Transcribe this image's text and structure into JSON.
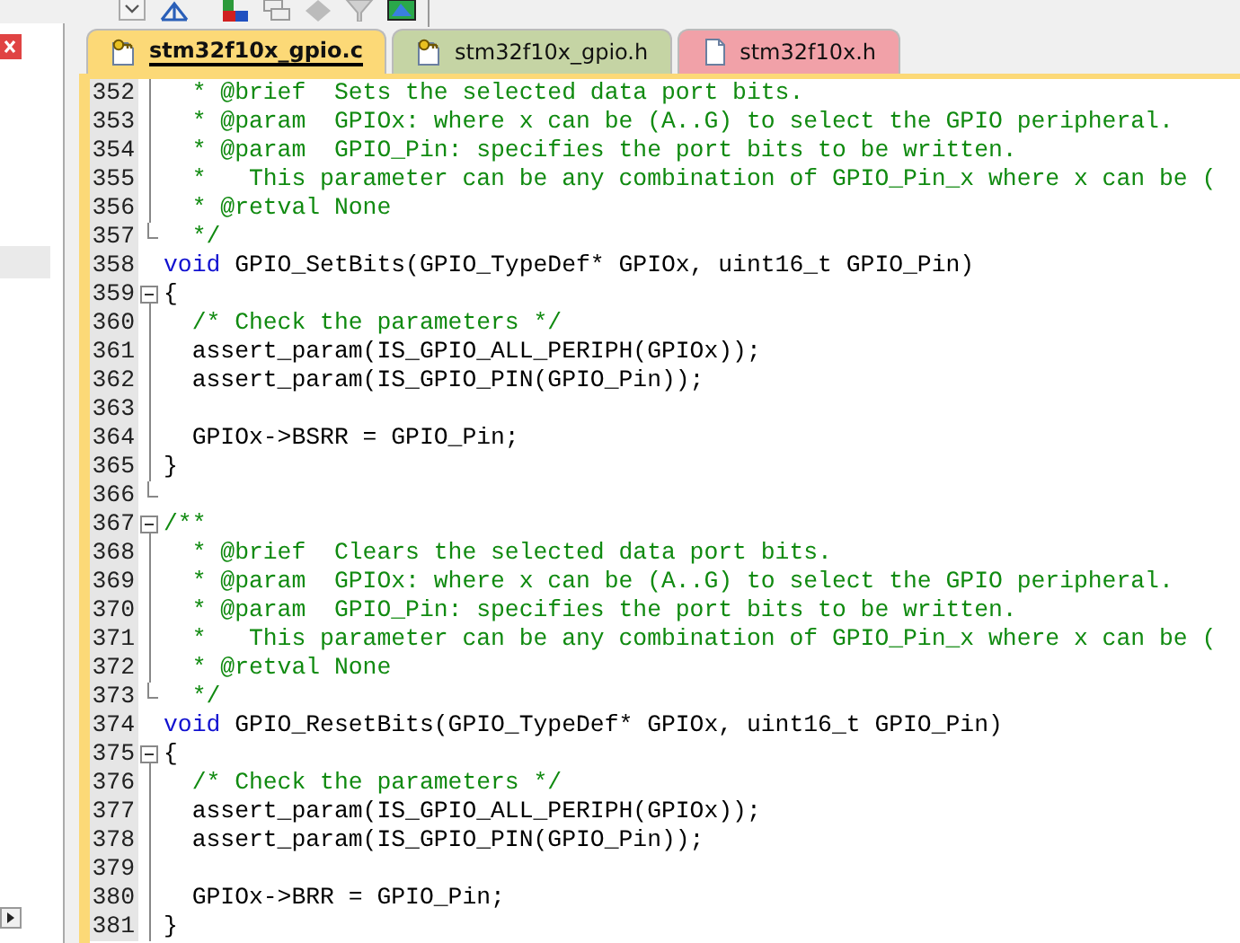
{
  "tabs": [
    {
      "label": "stm32f10x_gpio.c",
      "selected": true,
      "color": "#fcd977"
    },
    {
      "label": "stm32f10x_gpio.h",
      "selected": false,
      "color": "#c5d4a4"
    },
    {
      "label": "stm32f10x.h",
      "selected": false,
      "color": "#f1a1a8"
    }
  ],
  "lines": [
    {
      "number": "352",
      "kind": "line",
      "segments": [
        {
          "kind": "comment",
          "text": "  * @brief  Sets the selected data port bits."
        }
      ]
    },
    {
      "number": "353",
      "kind": "line",
      "segments": [
        {
          "kind": "comment",
          "text": "  * @param  GPIOx: where x can be (A..G) to select the GPIO peripheral."
        }
      ]
    },
    {
      "number": "354",
      "kind": "line",
      "segments": [
        {
          "kind": "comment",
          "text": "  * @param  GPIO_Pin: specifies the port bits to be written."
        }
      ]
    },
    {
      "number": "355",
      "kind": "line",
      "segments": [
        {
          "kind": "comment",
          "text": "  *   This parameter can be any combination of GPIO_Pin_x where x can be ("
        }
      ]
    },
    {
      "number": "356",
      "kind": "line",
      "segments": [
        {
          "kind": "comment",
          "text": "  * @retval None"
        }
      ]
    },
    {
      "number": "357",
      "kind": "end",
      "segments": [
        {
          "kind": "comment",
          "text": "  */"
        }
      ]
    },
    {
      "number": "358",
      "kind": "plain",
      "segments": [
        {
          "kind": "keyword",
          "text": "void"
        },
        {
          "kind": "code",
          "text": " GPIO_SetBits(GPIO_TypeDef* GPIOx, uint16_t GPIO_Pin)"
        }
      ]
    },
    {
      "number": "359",
      "kind": "open",
      "segments": [
        {
          "kind": "code",
          "text": "{"
        }
      ]
    },
    {
      "number": "360",
      "kind": "line",
      "segments": [
        {
          "kind": "comment",
          "text": "  /* Check the parameters */"
        }
      ]
    },
    {
      "number": "361",
      "kind": "line",
      "segments": [
        {
          "kind": "code",
          "text": "  assert_param(IS_GPIO_ALL_PERIPH(GPIOx));"
        }
      ]
    },
    {
      "number": "362",
      "kind": "line",
      "segments": [
        {
          "kind": "code",
          "text": "  assert_param(IS_GPIO_PIN(GPIO_Pin));"
        }
      ]
    },
    {
      "number": "363",
      "kind": "line"
    },
    {
      "number": "364",
      "kind": "line",
      "segments": [
        {
          "kind": "code",
          "text": "  GPIOx->BSRR = GPIO_Pin;"
        }
      ]
    },
    {
      "number": "365",
      "kind": "line",
      "segments": [
        {
          "kind": "code",
          "text": "}"
        }
      ]
    },
    {
      "number": "366",
      "kind": "end"
    },
    {
      "number": "367",
      "kind": "open",
      "segments": [
        {
          "kind": "comment",
          "text": "/**"
        }
      ]
    },
    {
      "number": "368",
      "kind": "line",
      "segments": [
        {
          "kind": "comment",
          "text": "  * @brief  Clears the selected data port bits."
        }
      ]
    },
    {
      "number": "369",
      "kind": "line",
      "segments": [
        {
          "kind": "comment",
          "text": "  * @param  GPIOx: where x can be (A..G) to select the GPIO peripheral."
        }
      ]
    },
    {
      "number": "370",
      "kind": "line",
      "segments": [
        {
          "kind": "comment",
          "text": "  * @param  GPIO_Pin: specifies the port bits to be written."
        }
      ]
    },
    {
      "number": "371",
      "kind": "line",
      "segments": [
        {
          "kind": "comment",
          "text": "  *   This parameter can be any combination of GPIO_Pin_x where x can be ("
        }
      ]
    },
    {
      "number": "372",
      "kind": "line",
      "segments": [
        {
          "kind": "comment",
          "text": "  * @retval None"
        }
      ]
    },
    {
      "number": "373",
      "kind": "end",
      "segments": [
        {
          "kind": "comment",
          "text": "  */"
        }
      ]
    },
    {
      "number": "374",
      "kind": "plain",
      "segments": [
        {
          "kind": "keyword",
          "text": "void"
        },
        {
          "kind": "code",
          "text": " GPIO_ResetBits(GPIO_TypeDef* GPIOx, uint16_t GPIO_Pin)"
        }
      ]
    },
    {
      "number": "375",
      "kind": "open",
      "segments": [
        {
          "kind": "code",
          "text": "{"
        }
      ]
    },
    {
      "number": "376",
      "kind": "line",
      "segments": [
        {
          "kind": "comment",
          "text": "  /* Check the parameters */"
        }
      ]
    },
    {
      "number": "377",
      "kind": "line",
      "segments": [
        {
          "kind": "code",
          "text": "  assert_param(IS_GPIO_ALL_PERIPH(GPIOx));"
        }
      ]
    },
    {
      "number": "378",
      "kind": "line",
      "segments": [
        {
          "kind": "code",
          "text": "  assert_param(IS_GPIO_PIN(GPIO_Pin));"
        }
      ]
    },
    {
      "number": "379",
      "kind": "line"
    },
    {
      "number": "380",
      "kind": "line",
      "segments": [
        {
          "kind": "code",
          "text": "  GPIOx->BRR = GPIO_Pin;"
        }
      ]
    },
    {
      "number": "381",
      "kind": "line",
      "segments": [
        {
          "kind": "code",
          "text": "}"
        }
      ]
    }
  ]
}
